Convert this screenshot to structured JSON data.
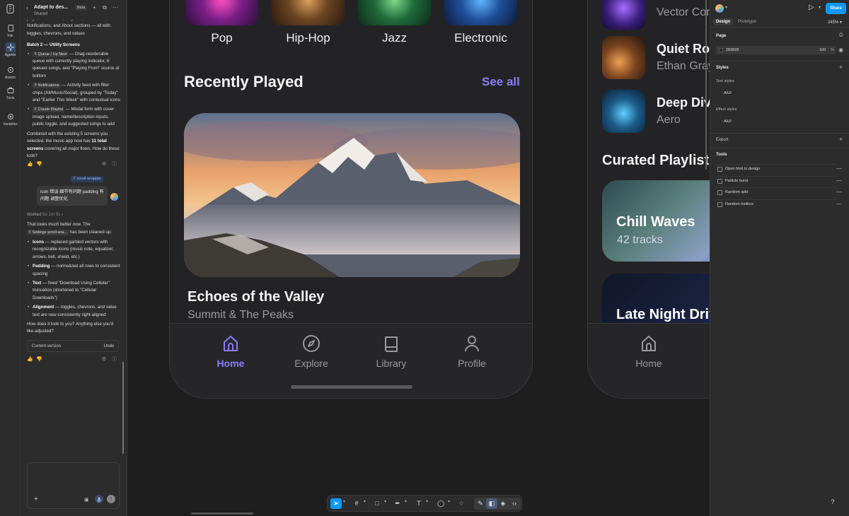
{
  "rail": {
    "items": [
      {
        "label": "File",
        "icon": "file-icon"
      },
      {
        "label": "Agents",
        "icon": "agents-icon"
      },
      {
        "label": "Assets",
        "icon": "assets-icon"
      },
      {
        "label": "Tools",
        "icon": "tools-icon"
      },
      {
        "label": "Variables",
        "icon": "variables-icon"
      }
    ]
  },
  "chat": {
    "title": "Adapt to des...",
    "subtitle": "Shared",
    "beta": "Beta",
    "intro": "page with Account, Playback, Downloads, Notifications, and About sections — all with toggles, chevrons, and values",
    "batch_title": "Batch 2 — Utility Screens",
    "batch_items": [
      {
        "chip": "⠿ Queue / Up Next",
        "text": " — Drag-reorderable queue with currently playing indicator, 6 queued songs, and \"Playing From\" source at bottom"
      },
      {
        "chip": "⠿ Notifications",
        "text": " — Activity feed with filter chips (All/Music/Social), grouped by \"Today\" and \"Earlier This Week\" with contextual icons"
      },
      {
        "chip": "⠿ Create Playlist",
        "text": " — Modal form with cover image upload, name/description inputs, public toggle, and suggested songs to add"
      }
    ],
    "summary_pre": "Combined with the existing 5 screens you selected, the music app now has ",
    "summary_bold": "11 total screens",
    "summary_post": " covering all major flows. How do these look?",
    "context_tag": "⠿ scroll-wrapper",
    "user_message": "icon 错误 细节有问题 padding 有问题 调整优化",
    "worked_label": "Worked",
    "worked_time": "for 1m 9s",
    "reply_pre": "That looks much better now. The",
    "reply_chip": "⠿ Settings scroll-wra...",
    "reply_post": "has been cleaned up:",
    "fixes": [
      {
        "bold": "Icons",
        "text": " — replaced garbled vectors with recognizable icons (music note, equalizer, arrows, bell, shield, etc.)"
      },
      {
        "bold": "Padding",
        "text": " — normalized all rows to consistent spacing"
      },
      {
        "bold": "Text",
        "text": " — fixed \"Download Using Cellular\" truncation (shortened to \"Cellular Downloads\")"
      },
      {
        "bold": "Alignment",
        "text": " — toggles, chevrons, and value text are now consistently right-aligned"
      }
    ],
    "closing": "How does it look to you? Anything else you'd like adjusted?",
    "version_label": "Current version",
    "undo_label": "Undo"
  },
  "phone1": {
    "genres": [
      "Pop",
      "Hip-Hop",
      "Jazz",
      "Electronic"
    ],
    "recent_title": "Recently Played",
    "see_all": "See all",
    "hero_title": "Echoes of the Valley",
    "hero_subtitle": "Summit & The Peaks",
    "tabs": [
      "Home",
      "Explore",
      "Library",
      "Profile"
    ]
  },
  "phone2": {
    "rows": [
      {
        "title": "",
        "subtitle": "Vector Core"
      },
      {
        "title": "Quiet Room",
        "subtitle": "Ethan Gray"
      },
      {
        "title": "Deep Dive",
        "subtitle": "Aero"
      }
    ],
    "playlists_title": "Curated Playlists",
    "playlists": [
      {
        "title": "Chill Waves",
        "subtitle": "42 tracks"
      },
      {
        "title": "Late Night Drive",
        "subtitle": ""
      }
    ],
    "tab_home": "Home"
  },
  "right_panel": {
    "share": "Share",
    "tabs": [
      "Design",
      "Prototype"
    ],
    "zoom": "245%",
    "page_heading": "Page",
    "fill_hex": "282828",
    "fill_opacity": "100",
    "percent": "%",
    "styles_heading": "Styles",
    "text_styles": "Text styles",
    "text_style_item": "AIUI",
    "effect_styles": "Effect styles",
    "effect_style_item": "AIUI",
    "export_heading": "Export",
    "tools_heading": "Tools",
    "tools": [
      "Open html.to.design",
      "Particle burst",
      "Random split",
      "Random toolbox"
    ],
    "help": "?"
  },
  "colors": {
    "accent": "#8b7cf6",
    "figma_blue": "#0d99ff",
    "panel_bg": "#2c2c2c",
    "canvas_bg": "#1e1e1e"
  }
}
